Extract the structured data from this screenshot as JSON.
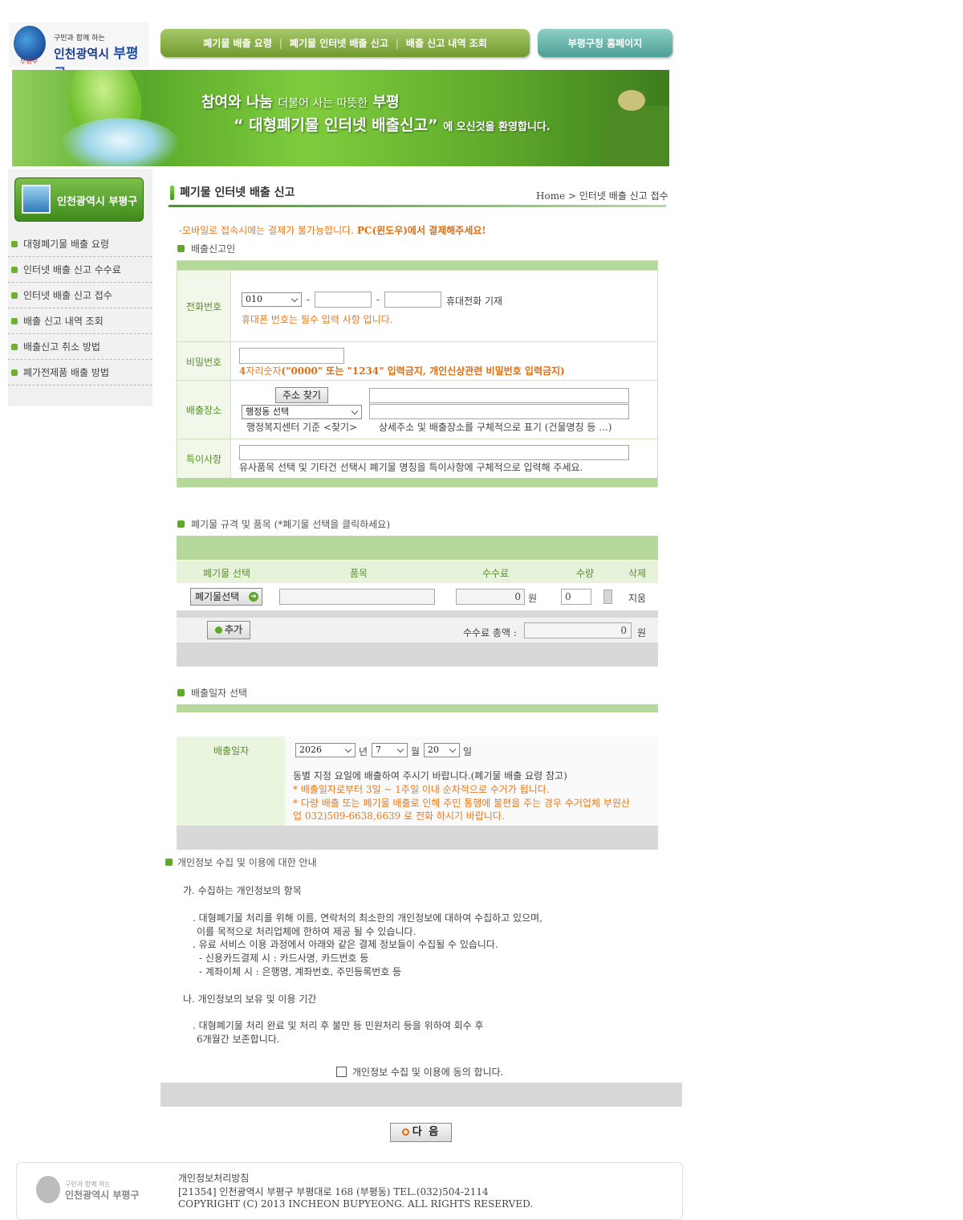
{
  "header": {
    "logo_small": "구민과 함께 하는",
    "logo_city": "인천광역시",
    "logo_district": "부평구",
    "logo_tiny": "부평구",
    "nav": [
      "폐기물 배출 요령",
      "폐기물 인터넷 배출 신고",
      "배출 신고 내역 조회"
    ],
    "home_button": "부평구청 홈페이지"
  },
  "banner": {
    "line1_a": "참여와 나눔",
    "line1_b": "더불어 사는 따뜻한",
    "line1_c": "부평",
    "line2_a": "“ 대형폐기물 인터넷 배출신고”",
    "line2_b": "에 오신것을 환영합니다."
  },
  "sidebar": {
    "box_label": "인천광역시 부평구",
    "items": [
      "대형폐기물 배출 요령",
      "인터넷 배출 신고 수수료",
      "인터넷 배출 신고 접수",
      "배출 신고 내역 조회",
      "배출신고 취소 방법",
      "폐가전제품 배출 방법"
    ]
  },
  "page": {
    "title": "폐기물 인터넷 배출 신고",
    "breadcrumb": "Home > 인터넷 배출 신고 접수",
    "warning_a": "-모바일로 접속시에는 결제가 불가능합니다.",
    "warning_b": "PC(윈도우)에서 결제해주세요!"
  },
  "applicant": {
    "section_title": "배출신고인",
    "phone_label": "전화번호",
    "phone_prefix": "010",
    "dash": "-",
    "phone_hint": "휴대전화 기재",
    "phone_required": "휴대폰 번호는 필수 입력 사항 입니다.",
    "password_label": "비밀번호",
    "password_note_a": "4",
    "password_note_b": "자리숫자",
    "password_note_c": "(\"0000\" 또는 \"1234\" 입력금지, 개인신상관련 비밀번호 입력금지)",
    "place_label": "배출장소",
    "address_button": "주소 찾기",
    "dong_select": "행정동 선택",
    "dong_hint": "행정복지센터 기준 <찾기>",
    "detail_hint": "상세주소 및 배출장소를 구체적으로 표기 (건물명칭 등 ...)",
    "special_label": "특이사항",
    "special_hint": "유사품목 선택 및 기타건 선택시 폐기물 명칭을 특이사항에 구체적으로 입력해 주세요."
  },
  "items": {
    "section_title": "폐기물 규격 및 품목 (*폐기물 선택을 클릭하세요)",
    "col_select": "폐기물 선택",
    "col_item": "품목",
    "col_fee": "수수료",
    "col_qty": "수량",
    "col_delete": "삭제",
    "select_button": "폐기물선택",
    "fee_value": "0",
    "won": "원",
    "qty_value": "0",
    "delete_label": "지움",
    "add_button": "추가",
    "total_label": "수수료 총액 :",
    "total_value": "0"
  },
  "date": {
    "section_title": "배출일자 선택",
    "label": "배출일자",
    "year": "2026",
    "year_unit": "년",
    "month": "7",
    "month_unit": "월",
    "day": "20",
    "day_unit": "일",
    "note1": "동별 지정 요일에 배출하여 주시기 바랍니다.(폐기물 배출 요령 참고)",
    "note2": "* 배출일자로부터 3일 ~ 1주일 이내 순차적으로 수거가 됩니다.",
    "note3": "* 다량 배출 또는 폐기물 배출로 인해 주민 통행에 불편을 주는 경우 수거업체 부원산",
    "note4": "업 032)509-6638,6639 로 전화 하시기 바랍니다."
  },
  "privacy": {
    "section_title": "개인정보 수집 및 이용에 대한 안내",
    "h1": "가. 수집하는 개인정보의 항목",
    "p1": ". 대형폐기물 처리를 위해 이름, 연락처의 최소한의 개인정보에 대하여 수집하고 있으며,",
    "p2": "이를 목적으로 처리업체에 한하여 제공 될 수 있습니다.",
    "p3": ". 유료 서비스 이용 과정에서 아래와 같은 결제 정보들이 수집될 수 있습니다.",
    "p4": "- 신용카드결제 시 : 카드사명, 카드번호 등",
    "p5": "- 계좌이체 시 : 은행명, 계좌번호, 주민등록번호 등",
    "h2": "나. 개인정보의 보유 및 이용 기간",
    "p6": ". 대형폐기물 처리 완료 및 처리 후 불만 등 민원처리 등을 위하여 회수 후",
    "p7": "6개월간 보존합니다.",
    "agree": "개인정보 수집 및 이용에 동의 합니다.",
    "next_button": "다 음"
  },
  "footer": {
    "policy": "개인정보처리방침",
    "address": "[21354] 인천광역시 부평구 부평대로 168 (부평동) TEL.(032)504-2114",
    "copyright": "COPYRIGHT (C) 2013 INCHEON BUPYEONG. ALL RIGHTS RESERVED.",
    "logo_small": "구민과 함께 하는",
    "logo_city": "인천광역시",
    "logo_district": "부평구"
  }
}
